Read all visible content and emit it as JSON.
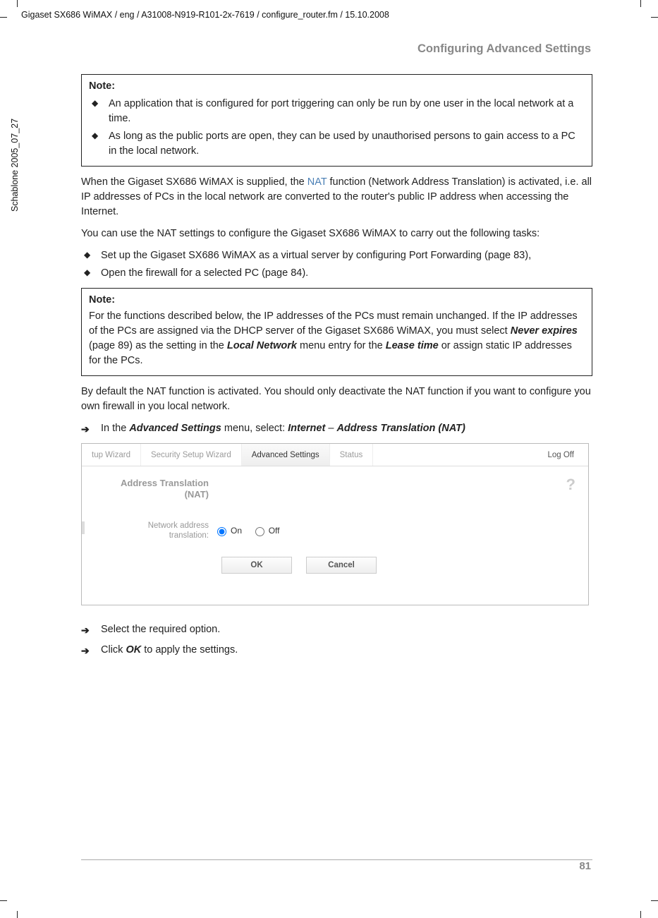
{
  "meta": {
    "header_path": "Gigaset SX686 WiMAX / eng / A31008-N919-R101-2x-7619 / configure_router.fm / 15.10.2008",
    "sidebar": "Schablone 2005_07_27",
    "section_heading": "Configuring Advanced Settings",
    "page_number": "81"
  },
  "note1": {
    "label": "Note:",
    "b1": "An application that is configured for port triggering can only be run by one user in the local network at a time.",
    "b2": "As long as the public ports are open, they can be used by unauthorised persons to gain access to a PC in the local network."
  },
  "p1": {
    "a": "When the Gigaset SX686 WiMAX is supplied, the ",
    "link": "NAT",
    "b": " function (Network Address Translation) is activated, i.e. all IP addresses of PCs in the local network are converted to the router's public IP address when accessing the Internet."
  },
  "p2": "You can use the NAT settings to configure the Gigaset SX686 WiMAX to carry out the following tasks:",
  "list1": {
    "b1": "Set up the Gigaset SX686 WiMAX as a virtual server by configuring Port Forwarding (page 83),",
    "b2": "Open the firewall for a selected PC (page 84)."
  },
  "note2": {
    "label": "Note:",
    "a": "For the functions described below, the IP addresses of the PCs must remain unchanged. If the IP addresses of the PCs are assigned via the DHCP server of the Gigaset SX686 WiMAX, you must select ",
    "bi1": "Never expires",
    "b": " (page 89) as the setting in the ",
    "bi2": "Local Network",
    "c": " menu entry for the ",
    "bi3": "Lease time",
    "d": " or assign static IP addresses for the PCs."
  },
  "p3": "By default the NAT function is activated. You should only deactivate the NAT function if you want to configure you own firewall in you local network.",
  "step1": {
    "a": "In the ",
    "bi1": "Advanced Settings",
    "b": " menu, select: ",
    "bi2": "Internet",
    "c": " – ",
    "bi3": "Address Translation (NAT)"
  },
  "ss": {
    "tabs": {
      "t1": "tup Wizard",
      "t2": "Security Setup Wizard",
      "t3": "Advanced Settings",
      "t4": "Status"
    },
    "logoff": "Log Off",
    "help": "?",
    "title": "Address Translation (NAT)",
    "row_label": "Network address translation:",
    "on": "On",
    "off": "Off",
    "ok": "OK",
    "cancel": "Cancel"
  },
  "step2": "Select the required option.",
  "step3": {
    "a": "Click ",
    "bi": "OK",
    "b": " to apply the settings."
  }
}
